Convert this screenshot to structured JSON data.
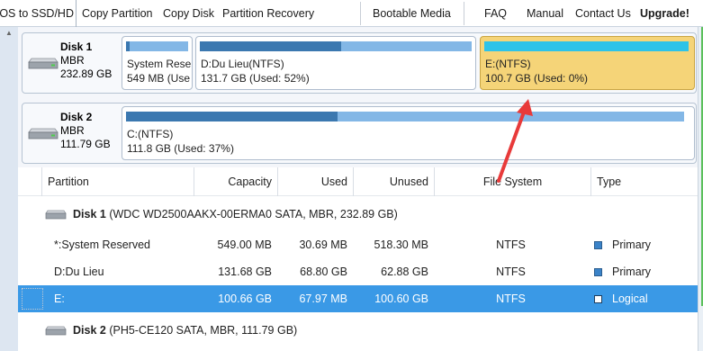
{
  "toolbar": {
    "items": [
      {
        "label": "OS to SSD/HD"
      },
      {
        "label": "Copy Partition"
      },
      {
        "label": "Copy Disk"
      },
      {
        "label": "Partition Recovery"
      },
      {
        "label": "Bootable Media"
      },
      {
        "label": "FAQ"
      },
      {
        "label": "Manual"
      },
      {
        "label": "Contact Us"
      },
      {
        "label": "Upgrade!"
      }
    ]
  },
  "disks": [
    {
      "name": "Disk 1",
      "style": "MBR",
      "size": "232.89 GB",
      "partitions": [
        {
          "line1": "System Rese",
          "line2": "549 MB (Use",
          "used_fraction": 0.06,
          "selected": false
        },
        {
          "line1": "D:Du Lieu(NTFS)",
          "line2": "131.7 GB (Used: 52%)",
          "used_fraction": 0.52,
          "selected": false
        },
        {
          "line1": "E:(NTFS)",
          "line2": "100.7 GB (Used: 0%)",
          "used_fraction": 0.0,
          "selected": true
        }
      ]
    },
    {
      "name": "Disk 2",
      "style": "MBR",
      "size": "111.79 GB",
      "partitions": [
        {
          "line1": "C:(NTFS)",
          "line2": "111.8 GB (Used: 37%)",
          "used_fraction": 0.37,
          "selected": false
        }
      ]
    }
  ],
  "table": {
    "headers": {
      "partition": "Partition",
      "capacity": "Capacity",
      "used": "Used",
      "unused": "Unused",
      "filesystem": "File System",
      "type": "Type"
    },
    "disk1": {
      "name": "Disk 1",
      "detail": "(WDC WD2500AAKX-00ERMA0 SATA, MBR, 232.89 GB)"
    },
    "disk2": {
      "name": "Disk 2",
      "detail": "(PH5-CE120 SATA, MBR, 111.79 GB)"
    },
    "rows": [
      {
        "name": "*:System Reserved",
        "capacity": "549.00 MB",
        "used": "30.69 MB",
        "unused": "518.30 MB",
        "fs": "NTFS",
        "type": "Primary"
      },
      {
        "name": "D:Du Lieu",
        "capacity": "131.68 GB",
        "used": "68.80 GB",
        "unused": "62.88 GB",
        "fs": "NTFS",
        "type": "Primary"
      },
      {
        "name": "E:",
        "capacity": "100.66 GB",
        "used": "67.97 MB",
        "unused": "100.60 GB",
        "fs": "NTFS",
        "type": "Logical"
      }
    ]
  },
  "colors": {
    "selected_partition": "#f5d478",
    "selected_row": "#3a99e6",
    "used_bar": "#3b78b0",
    "free_bar": "#83b7e6",
    "annotation_arrow": "#e83a3a"
  }
}
